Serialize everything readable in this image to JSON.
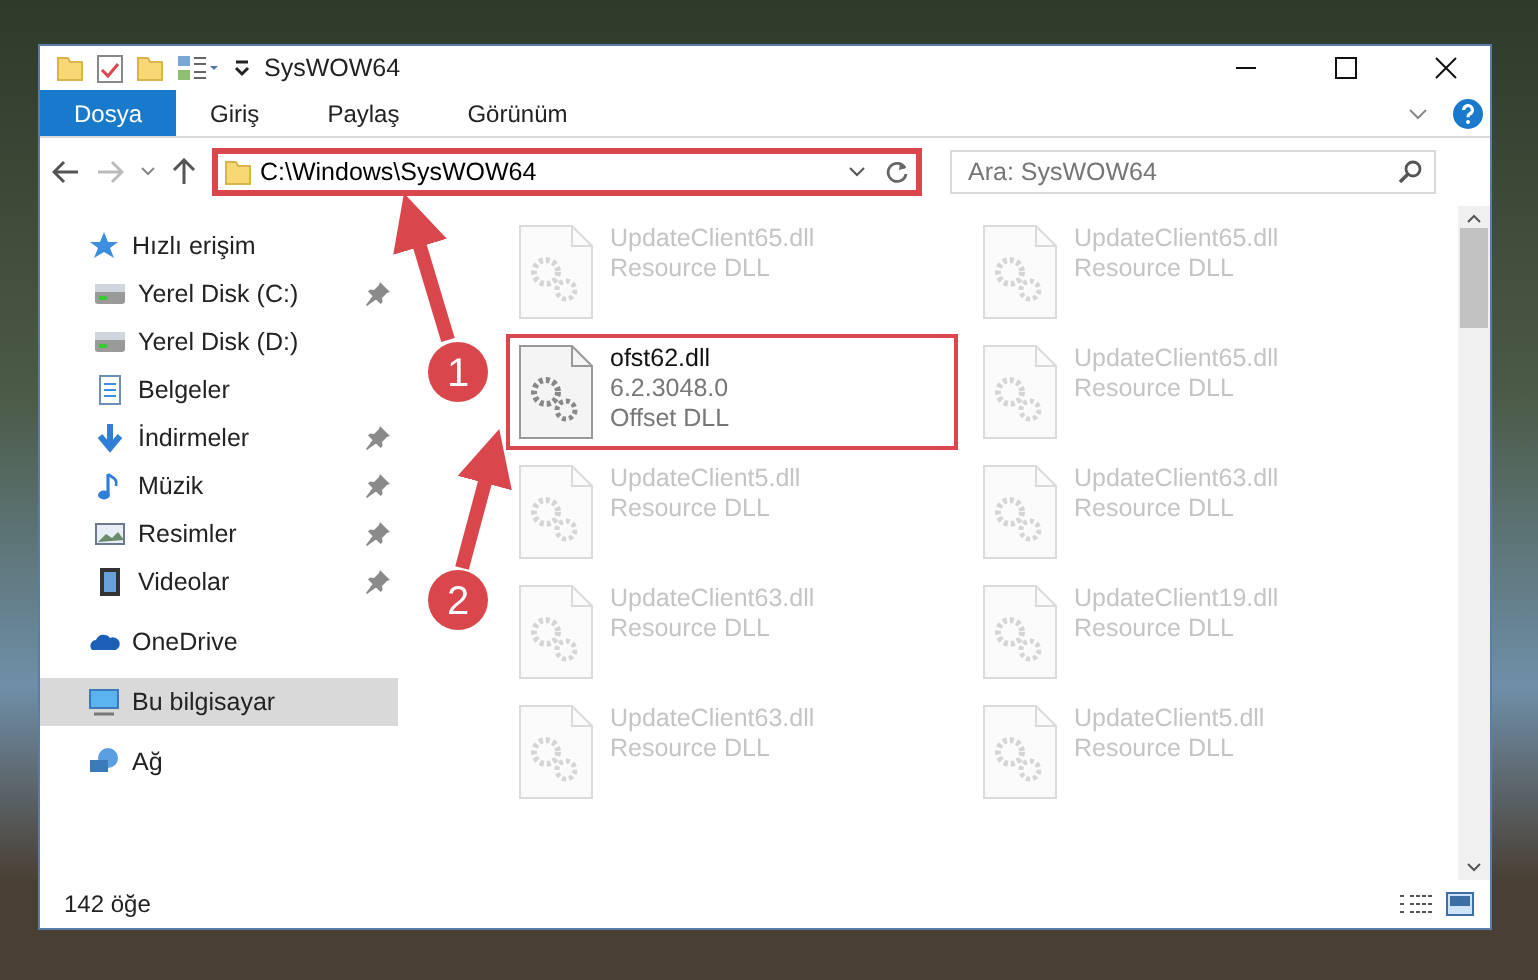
{
  "window": {
    "title": "SysWOW64"
  },
  "ribbon_tabs": [
    {
      "label": "Dosya",
      "selected": true
    },
    {
      "label": "Giriş",
      "selected": false
    },
    {
      "label": "Paylaş",
      "selected": false
    },
    {
      "label": "Görünüm",
      "selected": false
    }
  ],
  "address_bar": {
    "path": "C:\\Windows\\SysWOW64",
    "highlighted": true
  },
  "search": {
    "placeholder": "Ara: SysWOW64"
  },
  "nav_pane": {
    "items": [
      {
        "label": "Hızlı erişim",
        "kind": "star",
        "selected": false,
        "children": [
          {
            "label": "Yerel Disk (C:)",
            "kind": "drive",
            "selected": false,
            "pinned": true
          },
          {
            "label": "Yerel Disk (D:)",
            "kind": "drive",
            "selected": false,
            "pinned": false
          },
          {
            "label": "Belgeler",
            "kind": "document",
            "selected": false,
            "pinned": false
          },
          {
            "label": "İndirmeler",
            "kind": "download",
            "selected": false,
            "pinned": true
          },
          {
            "label": "Müzik",
            "kind": "music",
            "selected": false,
            "pinned": true
          },
          {
            "label": "Resimler",
            "kind": "pictures",
            "selected": false,
            "pinned": true
          },
          {
            "label": "Videolar",
            "kind": "video",
            "selected": false,
            "pinned": true
          }
        ]
      },
      {
        "label": "OneDrive",
        "kind": "cloud",
        "selected": false
      },
      {
        "label": "Bu bilgisayar",
        "kind": "pc",
        "selected": true
      },
      {
        "label": "Ağ",
        "kind": "network",
        "selected": false
      }
    ]
  },
  "files": [
    {
      "name": "UpdateClient65.dll",
      "lines": [
        "Resource DLL"
      ],
      "dimmed": true,
      "highlighted": false
    },
    {
      "name": "UpdateClient65.dll",
      "lines": [
        "Resource DLL"
      ],
      "dimmed": true,
      "highlighted": false
    },
    {
      "name": "ofst62.dll",
      "lines": [
        "6.2.3048.0",
        "Offset DLL"
      ],
      "dimmed": false,
      "highlighted": true
    },
    {
      "name": "UpdateClient65.dll",
      "lines": [
        "Resource DLL"
      ],
      "dimmed": true,
      "highlighted": false
    },
    {
      "name": "UpdateClient5.dll",
      "lines": [
        "Resource DLL"
      ],
      "dimmed": true,
      "highlighted": false
    },
    {
      "name": "UpdateClient63.dll",
      "lines": [
        "Resource DLL"
      ],
      "dimmed": true,
      "highlighted": false
    },
    {
      "name": "UpdateClient63.dll",
      "lines": [
        "Resource DLL"
      ],
      "dimmed": true,
      "highlighted": false
    },
    {
      "name": "UpdateClient19.dll",
      "lines": [
        "Resource DLL"
      ],
      "dimmed": true,
      "highlighted": false
    },
    {
      "name": "UpdateClient63.dll",
      "lines": [
        "Resource DLL"
      ],
      "dimmed": true,
      "highlighted": false
    },
    {
      "name": "UpdateClient5.dll",
      "lines": [
        "Resource DLL"
      ],
      "dimmed": true,
      "highlighted": false
    }
  ],
  "status_bar": {
    "count": "142 öğe"
  },
  "annotations": [
    {
      "number": "1"
    },
    {
      "number": "2"
    }
  ]
}
